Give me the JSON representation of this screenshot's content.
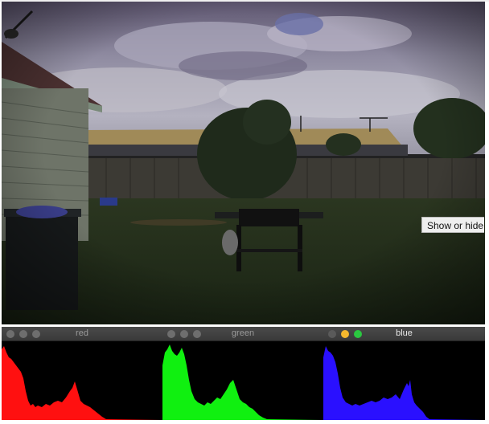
{
  "photo": {
    "description_icon": "backyard-photo"
  },
  "tooltip": {
    "text": "Show or hide d"
  },
  "histograms": [
    {
      "title": "red",
      "color": "#ff1010",
      "active": false
    },
    {
      "title": "green",
      "color": "#10f010",
      "active": false
    },
    {
      "title": "blue",
      "color": "#2a10ff",
      "active": true
    }
  ]
}
